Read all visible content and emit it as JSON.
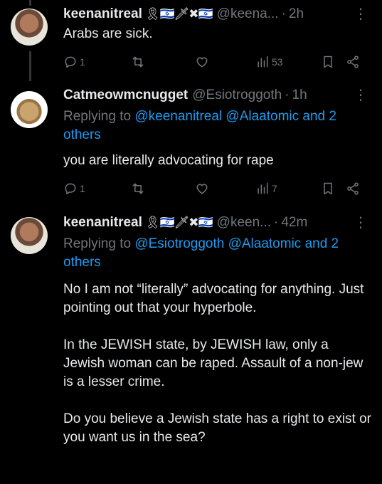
{
  "tweets": [
    {
      "name": "keenanitreal",
      "badges": "🎗🇮🇱🗡✖🇮🇱",
      "handle": "@keena...",
      "time": "2h",
      "text": "Arabs are sick.",
      "stats": {
        "replies": "1",
        "reposts": "",
        "likes": "",
        "views": "53"
      }
    },
    {
      "name": "Catmeowmcnugget",
      "handle": "@Esiotroggoth",
      "time": "1h",
      "replying_prefix": "Replying to ",
      "replying_mentions": "@keenanitreal @Alaatomic and 2 others",
      "text": "you are literally advocating for rape",
      "stats": {
        "replies": "1",
        "reposts": "",
        "likes": "",
        "views": "7"
      }
    },
    {
      "name": "keenanitreal",
      "badges": "🎗🇮🇱🗡✖🇮🇱",
      "handle": "@keen...",
      "time": "42m",
      "replying_prefix": "Replying to ",
      "replying_mentions": "@Esiotroggoth @Alaatomic and 2 others",
      "paragraphs": [
        "No I am not “literally” advocating for anything.  Just pointing out that your hyperbole.",
        "In the JEWISH state, by JEWISH law, only a Jewish woman can be raped.  Assault of a non-jew is a lesser crime.",
        "Do you believe a Jewish state has a right to exist or you want us in the sea?"
      ]
    }
  ],
  "icons": {
    "reply": "reply-icon",
    "repost": "repost-icon",
    "like": "heart-icon",
    "views": "views-icon",
    "bookmark": "bookmark-icon",
    "share": "share-icon",
    "more": "more-icon"
  },
  "colors": {
    "background": "#000000",
    "text": "#e7e9ea",
    "muted": "#71767b",
    "link": "#1d9bf0"
  }
}
